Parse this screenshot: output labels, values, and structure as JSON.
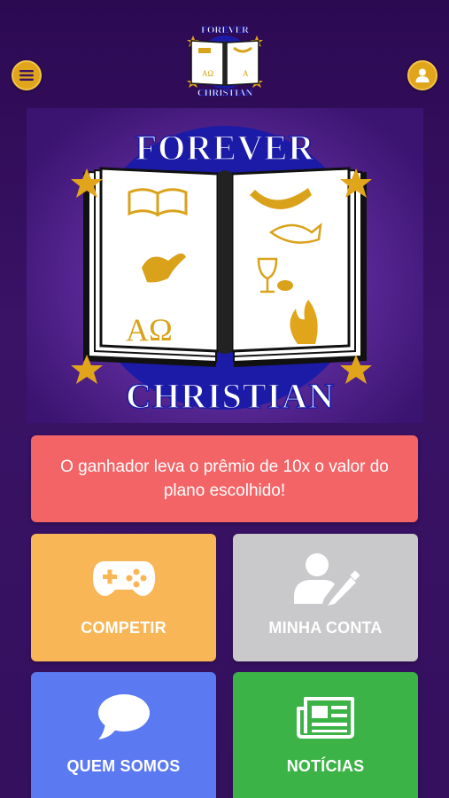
{
  "header": {
    "menu_icon": "hamburger-menu-icon",
    "profile_icon": "user-icon",
    "logo": {
      "top_text": "FOREVER",
      "bottom_text": "CHRISTIAN"
    }
  },
  "hero": {
    "logo_top_text": "FOREVER",
    "logo_bottom_text": "CHRISTIAN",
    "symbols": [
      "book",
      "shofar",
      "dove",
      "fish",
      "chalice",
      "alpha-omega",
      "flame"
    ]
  },
  "banner": {
    "text": "O ganhador leva o prêmio de 10x o valor do plano escolhido!",
    "color": "#f36467"
  },
  "tiles": [
    {
      "label": "COMPETIR",
      "icon": "gamepad-icon",
      "color": "#f8b656"
    },
    {
      "label": "MINHA CONTA",
      "icon": "user-edit-icon",
      "color": "#c9c9cb"
    },
    {
      "label": "QUEM SOMOS",
      "icon": "speech-bubble-icon",
      "color": "#5b79f1"
    },
    {
      "label": "NOTÍCIAS",
      "icon": "newspaper-icon",
      "color": "#3cb346"
    }
  ],
  "colors": {
    "background": "#2e0b55",
    "accent_gold": "#e0a51b",
    "logo_blue": "#1b1ba8"
  }
}
